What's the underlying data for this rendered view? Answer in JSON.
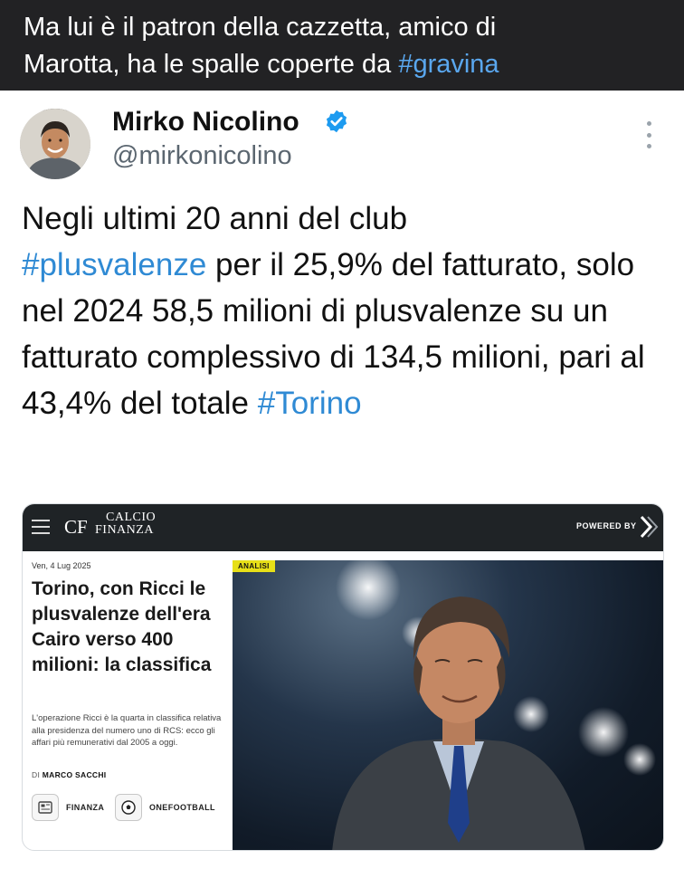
{
  "caption": {
    "text_line1": "Ma lui è il patron della cazzetta, amico di",
    "text_line2": "Marotta, ha le spalle coperte da ",
    "hashtag": "#gravina"
  },
  "tweet": {
    "author_name": "Mirko Nicolino",
    "handle": "@mirkonicolino",
    "verified": true,
    "text_part1": "Negli ultimi 20 anni del club ",
    "hashtag1": "#plusvalenze",
    "text_part2": " per il 25,9% del fatturato, solo nel 2024 58,5 milioni di plusvalenze su un fatturato complessivo di 134,5 milioni, pari al 43,4% del totale ",
    "hashtag2": "#Torino"
  },
  "media": {
    "site_logo_short": "CF",
    "site_logo_line1": "CALCIO",
    "site_logo_line2": "FINANZA",
    "powered_by": "POWERED BY",
    "date": "Ven, 4 Lug 2025",
    "badge": "ANALISI",
    "title": "Torino, con Ricci le plusvalenze dell'era Cairo verso 400 milioni: la classifica",
    "description": "L'operazione Ricci è la quarta in classifica relativa alla presidenza del numero uno di RCS: ecco gli affari più remunerativi dal 2005 a oggi.",
    "author_prefix": "DI",
    "author": "MARCO SACCHI",
    "tags": [
      {
        "label": "FINANZA",
        "icon": "newspaper-icon"
      },
      {
        "label": "ONEFOOTBALL",
        "icon": "football-icon"
      }
    ]
  },
  "colors": {
    "caption_bg": "#222224",
    "hashtag": "#2f8ad4",
    "verified": "#1d9bf0",
    "badge": "#e7df18"
  }
}
